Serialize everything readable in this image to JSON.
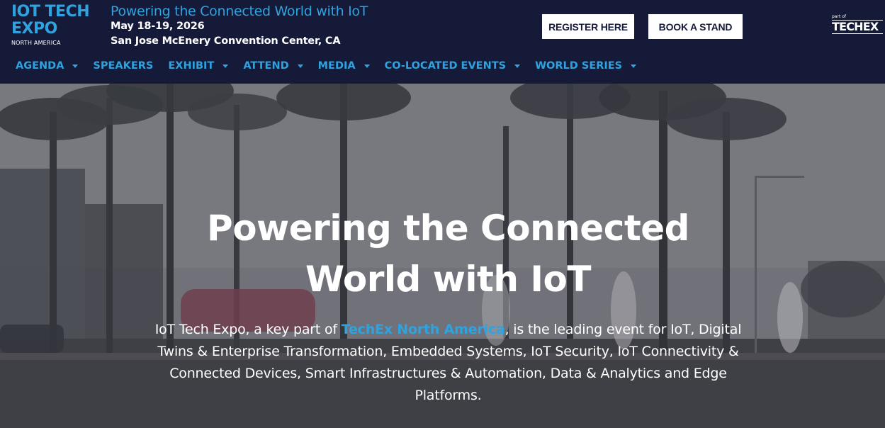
{
  "logo": {
    "line1": "IOT TECH",
    "line2": "EXPO",
    "sub": "NORTH AMERICA"
  },
  "event": {
    "tagline": "Powering the Connected World with IoT",
    "date": "May 18-19, 2026",
    "venue": "San Jose McEnery Convention Center, CA"
  },
  "cta": {
    "register": "REGISTER HERE",
    "book_stand": "BOOK A STAND"
  },
  "techex": {
    "part_of": "part of",
    "brand": "TECHEX"
  },
  "nav": [
    {
      "label": "AGENDA",
      "dropdown": true
    },
    {
      "label": "SPEAKERS",
      "dropdown": false
    },
    {
      "label": "EXHIBIT",
      "dropdown": true
    },
    {
      "label": "ATTEND",
      "dropdown": true
    },
    {
      "label": "MEDIA",
      "dropdown": true
    },
    {
      "label": "CO-LOCATED EVENTS",
      "dropdown": true
    },
    {
      "label": "WORLD SERIES",
      "dropdown": true
    }
  ],
  "hero": {
    "title_line1": "Powering the Connected",
    "title_line2": "World with IoT",
    "desc_prefix": "IoT Tech Expo, a key part of ",
    "desc_link": "TechEx North America",
    "desc_suffix": ", is the leading event for IoT, Digital Twins & Enterprise Transformation, Embedded Systems, IoT Security, IoT Connectivity & Connected Devices, Smart Infrastructures & Automation, Data & Analytics and Edge Platforms."
  },
  "colors": {
    "navy": "#151a39",
    "accent_blue": "#2ea3e0",
    "white": "#ffffff"
  }
}
